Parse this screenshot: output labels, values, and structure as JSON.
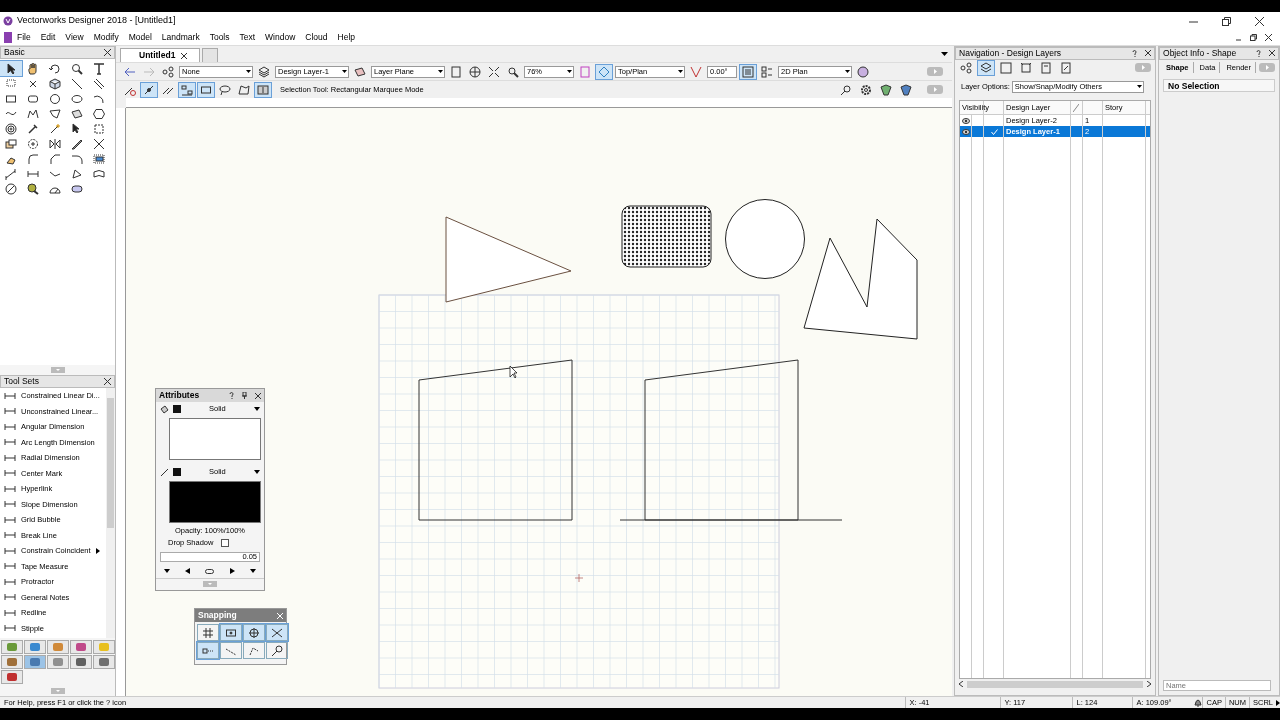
{
  "window": {
    "title": "Vectorworks Designer 2018 - [Untitled1]"
  },
  "menu": [
    "File",
    "Edit",
    "View",
    "Modify",
    "Model",
    "Landmark",
    "Tools",
    "Text",
    "Window",
    "Cloud",
    "Help"
  ],
  "basic_palette": {
    "title": "Basic"
  },
  "tool_sets": {
    "title": "Tool Sets",
    "items": [
      {
        "label": "Constrained Linear Di...",
        "submenu": false
      },
      {
        "label": "Unconstrained Linear...",
        "submenu": false
      },
      {
        "label": "Angular Dimension",
        "submenu": false
      },
      {
        "label": "Arc Length Dimension",
        "submenu": false
      },
      {
        "label": "Radial Dimension",
        "submenu": false
      },
      {
        "label": "Center Mark",
        "submenu": false
      },
      {
        "label": "Hyperlink",
        "submenu": false
      },
      {
        "label": "Slope Dimension",
        "submenu": false
      },
      {
        "label": "Grid Bubble",
        "submenu": false
      },
      {
        "label": "Break Line",
        "submenu": false
      },
      {
        "label": "Constrain Coincident",
        "submenu": true
      },
      {
        "label": "Tape Measure",
        "submenu": false
      },
      {
        "label": "Protractor",
        "submenu": false
      },
      {
        "label": "General Notes",
        "submenu": false
      },
      {
        "label": "Redline",
        "submenu": false
      },
      {
        "label": "Stipple",
        "submenu": false
      }
    ],
    "sets": [
      {
        "color": "#6a9a3a",
        "selected": false
      },
      {
        "color": "#3a8ad0",
        "selected": false
      },
      {
        "color": "#d08a3a",
        "selected": false
      },
      {
        "color": "#c04a8a",
        "selected": false
      },
      {
        "color": "#e8c020",
        "selected": false
      },
      {
        "color": "#a0703a",
        "selected": false
      },
      {
        "color": "#4a7ab0",
        "selected": true
      },
      {
        "color": "#909090",
        "selected": false
      },
      {
        "color": "#606060",
        "selected": false
      },
      {
        "color": "#707070",
        "selected": false
      },
      {
        "color": "#c03030",
        "selected": false
      }
    ]
  },
  "document_tabs": [
    {
      "label": "Untitled1",
      "selected": true
    }
  ],
  "view_bar": {
    "class": "None",
    "layer": "Design Layer-1",
    "plane": "Layer Plane",
    "zoom": "76%",
    "view": "Top/Plan",
    "rotation": "0.00°",
    "render_mode": "2D Plan"
  },
  "mode_bar": {
    "hint": "Selection Tool: Rectangular Marquee Mode"
  },
  "attributes": {
    "title": "Attributes",
    "fill_style": "Solid",
    "pen_style": "Solid",
    "opacity": "Opacity: 100%/100%",
    "drop_shadow": {
      "label": "Drop Shadow",
      "checked": false
    },
    "line_weight": "0.05"
  },
  "snapping": {
    "title": "Snapping",
    "buttons": [
      {
        "selected": false
      },
      {
        "selected": true
      },
      {
        "selected": true
      },
      {
        "selected": true
      },
      {
        "selected": true
      },
      {
        "selected": false
      },
      {
        "selected": false
      },
      {
        "selected": false
      }
    ]
  },
  "navigation": {
    "title": "Navigation - Design Layers",
    "layer_options_label": "Layer Options:",
    "layer_options": "Show/Snap/Modify Others",
    "columns": [
      "Visibility",
      "Design Layer",
      "Story"
    ],
    "rows": [
      {
        "name": "Design Layer-2",
        "stack_order": "1",
        "active": false,
        "selected": false
      },
      {
        "name": "Design Layer-1",
        "stack_order": "2",
        "active": true,
        "selected": true
      }
    ]
  },
  "object_info": {
    "title": "Object Info - Shape",
    "tabs": [
      {
        "label": "Shape",
        "selected": true
      },
      {
        "label": "Data",
        "selected": false
      },
      {
        "label": "Render",
        "selected": false
      }
    ],
    "status": "No Selection",
    "name_placeholder": "Name"
  },
  "status_bar": {
    "help": "For Help, press F1 or click the ? icon",
    "x": "X: -41",
    "y": "Y: 117",
    "length": "L: 124",
    "angle": "A: 109.09°",
    "indicators": [
      "CAP",
      "NUM",
      "SCRL"
    ]
  }
}
